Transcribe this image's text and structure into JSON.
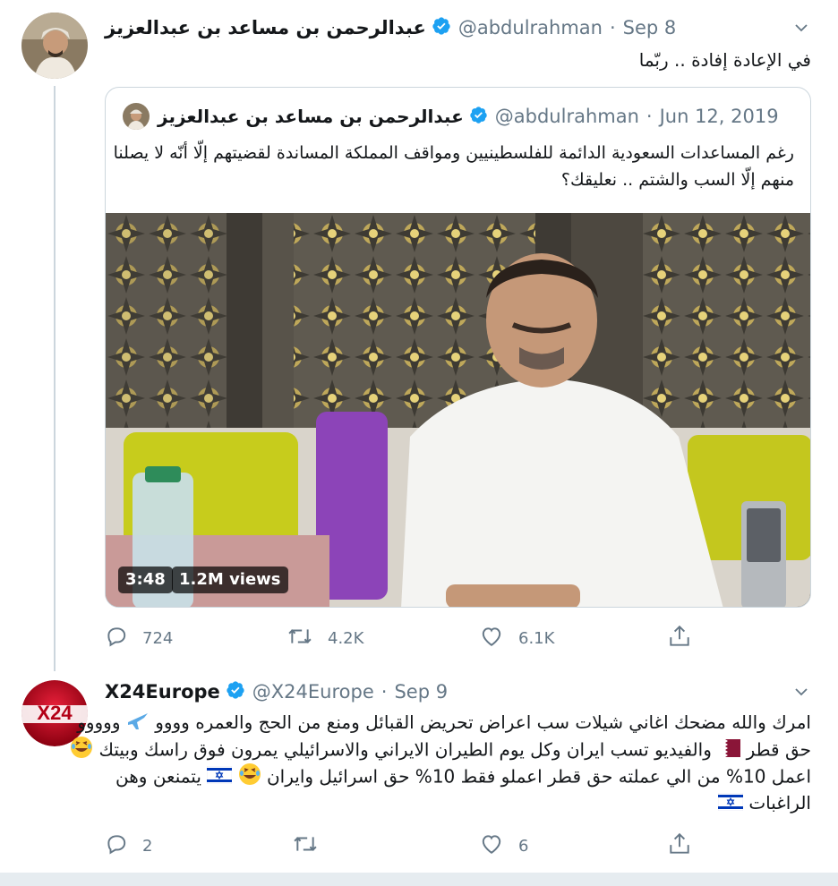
{
  "tweet1": {
    "author_name": "عبدالرحمن بن مساعد بن عبدالعزيز",
    "handle": "@abdulrahman",
    "sep": "·",
    "date": "Sep 8",
    "text": "في الإعادة إفادة .. ربّما",
    "quoted": {
      "author_name": "عبدالرحمن بن مساعد بن عبدالعزيز",
      "handle": "@abdulrahman",
      "sep": "·",
      "date": "Jun 12, 2019",
      "text_line1": "رغم المساعدات السعودية الدائمة للفلسطينيين ومواقف المملكة المساندة لقضيتهم إلّا أنّه لا يصلنا",
      "text_line2": "منهم إلّا السب والشتم .. نعليقك؟",
      "video_duration": "3:48",
      "video_views": "1.2M views"
    },
    "actions": {
      "replies": "724",
      "retweets": "4.2K",
      "likes": "6.1K"
    }
  },
  "tweet2": {
    "author_name": "X24Europe",
    "avatar_text": "X24",
    "handle": "@X24Europe",
    "sep": "·",
    "date": "Sep 9",
    "line1": "امرك والله مضحك اغاني شيلات سب اعراض تحريض القبائل ومنع من الحج والعمره وووو",
    "line1_suffix": "ووووو",
    "line2a": "حق قطر",
    "line2b": "والفيديو تسب ايران وكل يوم الطيران الايراني والاسرائيلي يمرون فوق راسك وبيتك",
    "line3a": "اعمل 10% من الي عملته حق قطر اعملو فقط 10% حق اسرائيل وايران",
    "line3b": "يتمنعن وهن",
    "line4": "الراغبات",
    "actions": {
      "replies": "2",
      "retweets": "",
      "likes": "6"
    }
  },
  "colors": {
    "link_blue": "#1da1f2",
    "muted": "#657786",
    "border": "#ccd6dd",
    "background_strip": "#e6ecf0"
  },
  "icons": [
    "verified-badge-icon",
    "chevron-down-icon",
    "reply-icon",
    "retweet-icon",
    "like-icon",
    "share-icon",
    "airplane-emoji-icon",
    "laughing-emoji-icon",
    "qatar-flag-icon",
    "israel-flag-icon"
  ]
}
